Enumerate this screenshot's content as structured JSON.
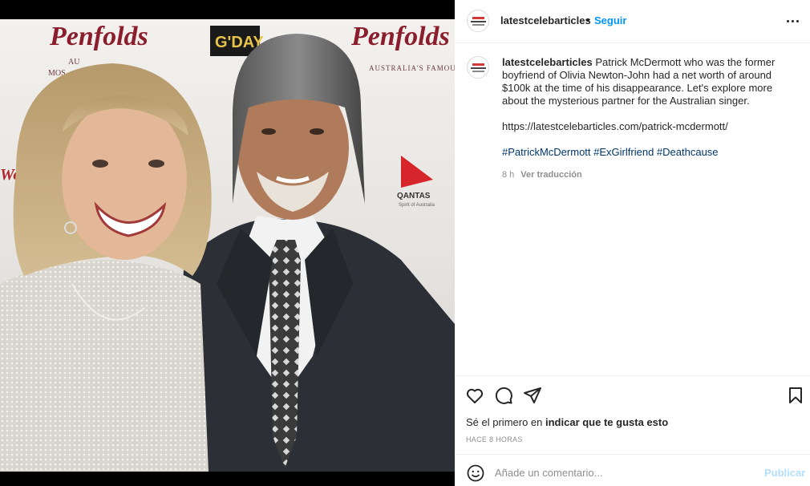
{
  "post": {
    "username": "latestcelebarticles",
    "separator": "•",
    "follow_label": "Seguir",
    "caption_text": "Patrick McDermott who was the former boyfriend of Olivia Newton-John had a net worth of around $100k at the time of his disappearance. Let's explore more about the mysterious partner for the Australian singer.",
    "link": "https://latestcelebarticles.com/patrick-mcdermott/",
    "hashtags": [
      "#PatrickMcDermott",
      "#ExGirlfriend",
      "#Deathcause"
    ],
    "age": "8 h",
    "translate_label": "Ver traducción",
    "likes_prefix": "Sé el primero en ",
    "likes_bold": "indicar que te gusta esto",
    "timestamp": "HACE 8 HORAS",
    "comment_placeholder": "Añade un comentario...",
    "publish_label": "Publicar"
  },
  "photo": {
    "backdrop_text_1": "Penfolds",
    "backdrop_text_2": "Penfolds",
    "backdrop_text_3": "G'DAY",
    "backdrop_text_4": "AUSTRALIA'S FAMOUS WINE",
    "backdrop_text_5": "QANTAS",
    "backdrop_text_6": "Spirit of Australia",
    "backdrop_text_7": "Westf",
    "backdrop_text_8": "AU",
    "backdrop_text_9": "MOS"
  },
  "colors": {
    "accent": "#0095f6",
    "hashtag": "#00376b",
    "muted": "#8e8e8e",
    "publish_disabled": "#b2dffc"
  },
  "icons": {
    "more": "more-horizontal-icon",
    "like": "heart-icon",
    "comment": "comment-bubble-icon",
    "share": "paper-plane-icon",
    "save": "bookmark-icon",
    "emoji": "emoji-smile-icon"
  }
}
